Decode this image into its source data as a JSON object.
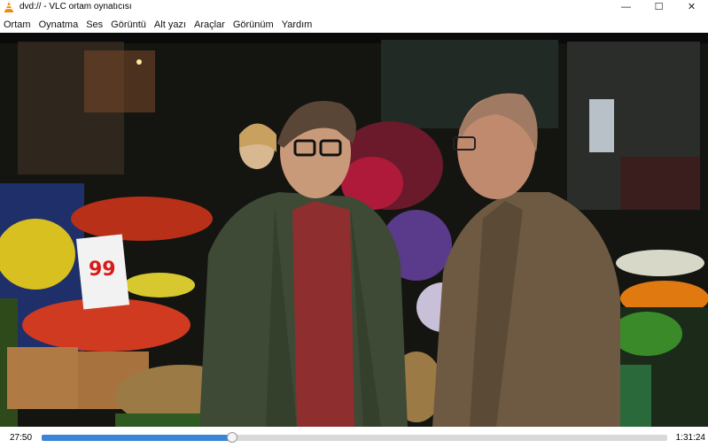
{
  "window": {
    "title": "dvd:// - VLC ortam oynatıcısı",
    "icon": "vlc-cone-icon",
    "controls": {
      "minimize": "—",
      "maximize": "☐",
      "close": "✕"
    }
  },
  "menu": {
    "items": [
      "Ortam",
      "Oynatma",
      "Ses",
      "Görüntü",
      "Alt yazı",
      "Araçlar",
      "Görünüm",
      "Yardım"
    ]
  },
  "video": {
    "content": "movie-frame",
    "price_sign": "99"
  },
  "playback": {
    "elapsed": "27:50",
    "total": "1:31:24",
    "progress": 0.3046
  },
  "colors": {
    "seek_fill": "#3a86d6",
    "vlc_orange": "#f08a00"
  }
}
